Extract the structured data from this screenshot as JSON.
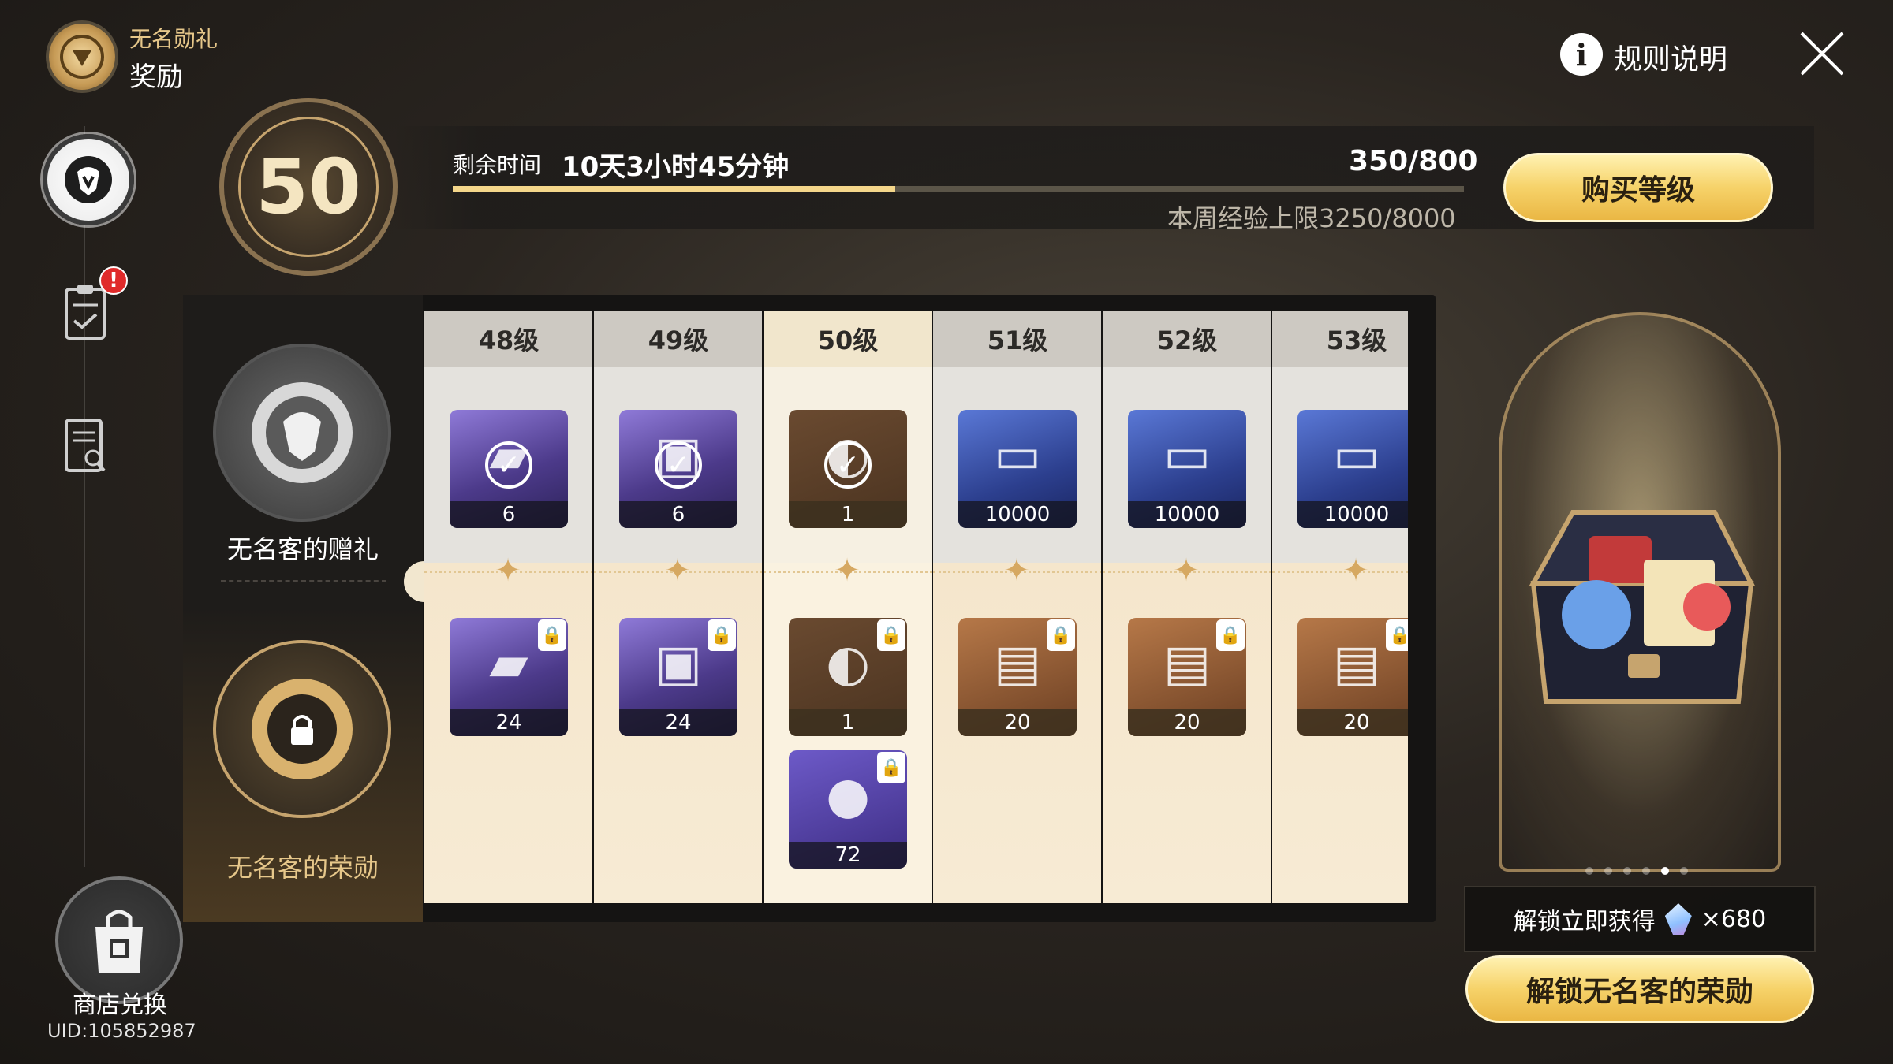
{
  "header": {
    "subtitle": "无名勋礼",
    "title": "奖励",
    "rules_label": "规则说明",
    "rules_icon": "i"
  },
  "nav": {
    "badge": "!",
    "shop_label": "商店兑换",
    "uid": "UID:105852987"
  },
  "level": {
    "current": "50",
    "remaining_label": "剩余时间",
    "remaining_value": "10天3小时45分钟",
    "exp": "350/800",
    "exp_fraction": 0.4375,
    "weekly_cap": "本周经验上限3250/8000",
    "buy_label": "购买等级"
  },
  "tiers": {
    "free_label": "无名客的赠礼",
    "premium_label": "无名客的荣勋"
  },
  "columns": [
    {
      "level": "48级",
      "free": {
        "qty": "6",
        "claimed": true,
        "icon": "relic-book-icon"
      },
      "premium": [
        {
          "qty": "24",
          "locked": true,
          "icon": "relic-book-icon"
        }
      ]
    },
    {
      "level": "49级",
      "free": {
        "qty": "6",
        "claimed": true,
        "icon": "lantern-icon"
      },
      "premium": [
        {
          "qty": "24",
          "locked": true,
          "icon": "lantern-icon"
        }
      ]
    },
    {
      "level": "50级",
      "free": {
        "qty": "1",
        "claimed": true,
        "icon": "horn-icon"
      },
      "premium": [
        {
          "qty": "1",
          "locked": true,
          "icon": "horn-icon"
        },
        {
          "qty": "72",
          "locked": true,
          "icon": "essence-drop-icon"
        }
      ]
    },
    {
      "level": "51级",
      "free": {
        "qty": "10000",
        "claimed": false,
        "icon": "credit-card-icon"
      },
      "premium": [
        {
          "qty": "20",
          "locked": true,
          "icon": "guide-book-icon"
        }
      ]
    },
    {
      "level": "52级",
      "free": {
        "qty": "10000",
        "claimed": false,
        "icon": "credit-card-icon"
      },
      "premium": [
        {
          "qty": "20",
          "locked": true,
          "icon": "guide-book-icon"
        }
      ]
    },
    {
      "level": "53级",
      "free": {
        "qty": "10000",
        "claimed": false,
        "icon": "credit-card-icon"
      },
      "premium": [
        {
          "qty": "20",
          "locked": true,
          "icon": "guide-book-icon"
        }
      ]
    }
  ],
  "preview": {
    "unlock_info_label": "解锁立即获得",
    "unlock_info_qty": "×680",
    "unlock_button": "解锁无名客的荣勋",
    "dots": 6,
    "active_dot": 4
  }
}
